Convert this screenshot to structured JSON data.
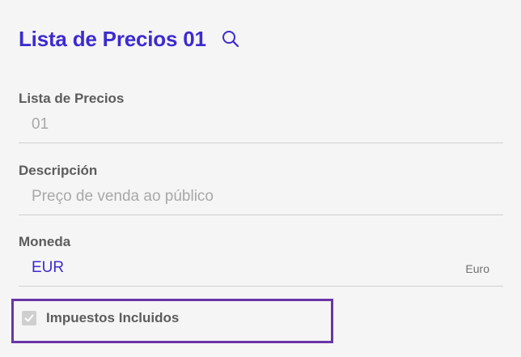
{
  "header": {
    "title": "Lista de Precios 01",
    "search_icon": "search-icon"
  },
  "fields": {
    "price_list": {
      "label": "Lista de Precios",
      "value": "01"
    },
    "description": {
      "label": "Descripción",
      "value": "Preço de venda ao público"
    },
    "currency": {
      "label": "Moneda",
      "value": "EUR",
      "secondary": "Euro"
    }
  },
  "taxes_included": {
    "label": "Impuestos Incluidos",
    "checked": true,
    "disabled": true
  },
  "colors": {
    "accent": "#3d2bd0",
    "highlight_border": "#6a35a6",
    "muted_text": "#a8a8a8"
  }
}
